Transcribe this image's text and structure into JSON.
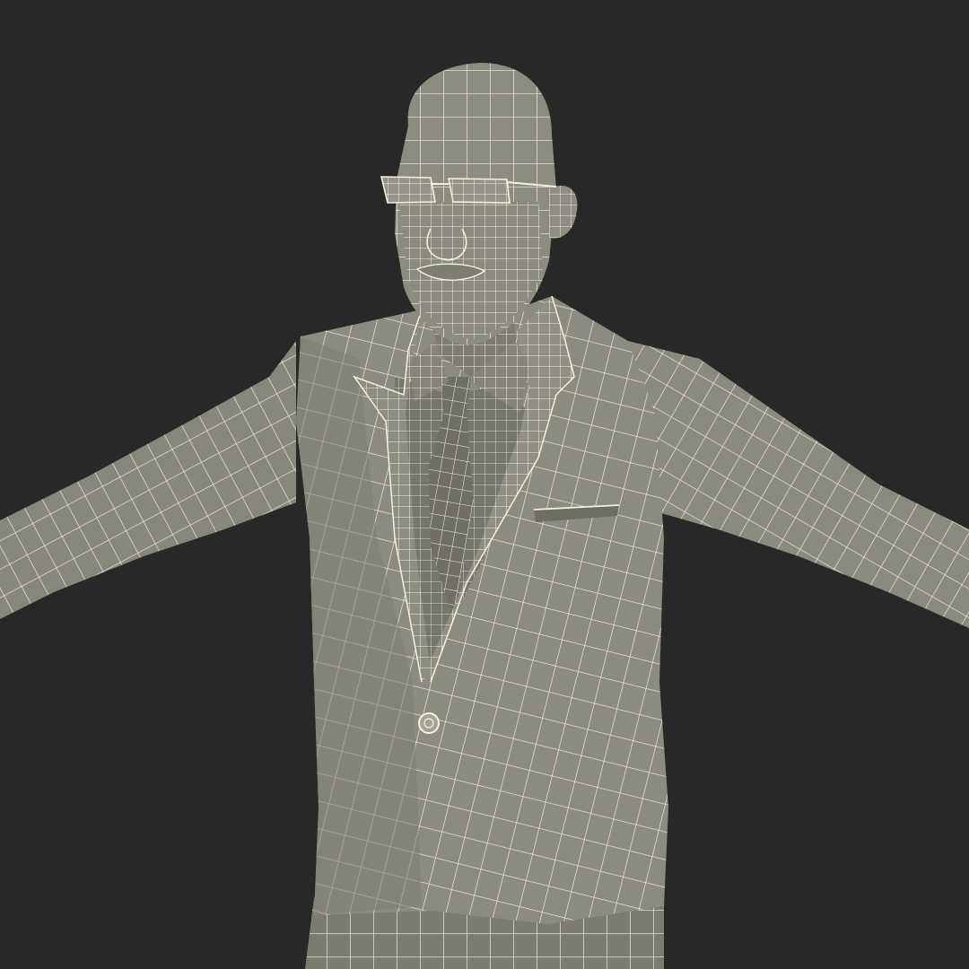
{
  "scene": {
    "subject": "wireframe-man-in-suit",
    "colors": {
      "background": "#282828",
      "mesh_fill": "#8a8a7c",
      "mesh_fill_dark": "#6f6f63",
      "mesh_fill_shadow": "#5d5d52",
      "wire": "#f4f2e0"
    }
  }
}
